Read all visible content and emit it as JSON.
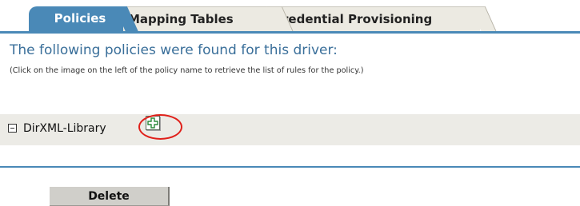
{
  "tabs": [
    {
      "label": "Policies",
      "active": true
    },
    {
      "label": "Mapping Tables",
      "active": false
    },
    {
      "label": "Credential Provisioning",
      "active": false
    }
  ],
  "heading": "The following policies were found for this driver:",
  "instruction": "(Click on the image on the left of the policy name to retrieve the list of rules for the policy.)",
  "policies": [
    {
      "name": "DirXML-Library",
      "expanded": false
    }
  ],
  "actions": {
    "delete_label": "Delete"
  },
  "colors": {
    "accent": "#4a89b7",
    "heading_text": "#3a6f9a",
    "inactive_tab": "#eceae2",
    "row_background": "#ecebe6",
    "highlight": "#e0201a",
    "button_background": "#d0cfca"
  },
  "icons": {
    "collapse": "minus-square-icon",
    "expand": "plus-cross-icon"
  }
}
